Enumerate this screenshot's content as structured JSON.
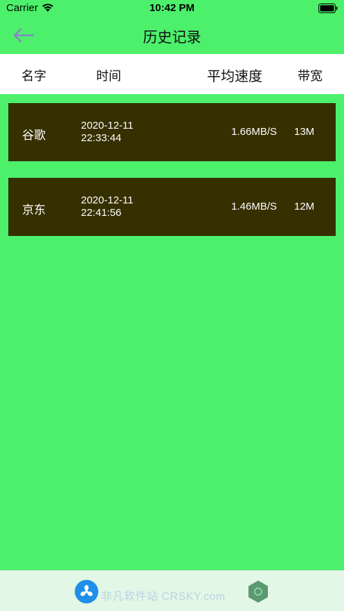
{
  "status_bar": {
    "carrier": "Carrier",
    "time": "10:42 PM"
  },
  "nav": {
    "title": "历史记录",
    "back_icon": "arrow-left-icon"
  },
  "table": {
    "headers": {
      "name": "名字",
      "time": "时间",
      "speed": "平均速度",
      "bandwidth": "带宽"
    },
    "rows": [
      {
        "name": "谷歌",
        "date": "2020-12-11",
        "clock": "22:33:44",
        "speed": "1.66MB/S",
        "bandwidth": "13M"
      },
      {
        "name": "京东",
        "date": "2020-12-11",
        "clock": "22:41:56",
        "speed": "1.46MB/S",
        "bandwidth": "12M"
      }
    ]
  },
  "bottom": {
    "watermark": "非凡软件站 CRSKY.com"
  },
  "colors": {
    "background": "#4cf06b",
    "row_background": "#362f00",
    "header_background": "#ffffff",
    "back_arrow": "#8a84c8"
  }
}
